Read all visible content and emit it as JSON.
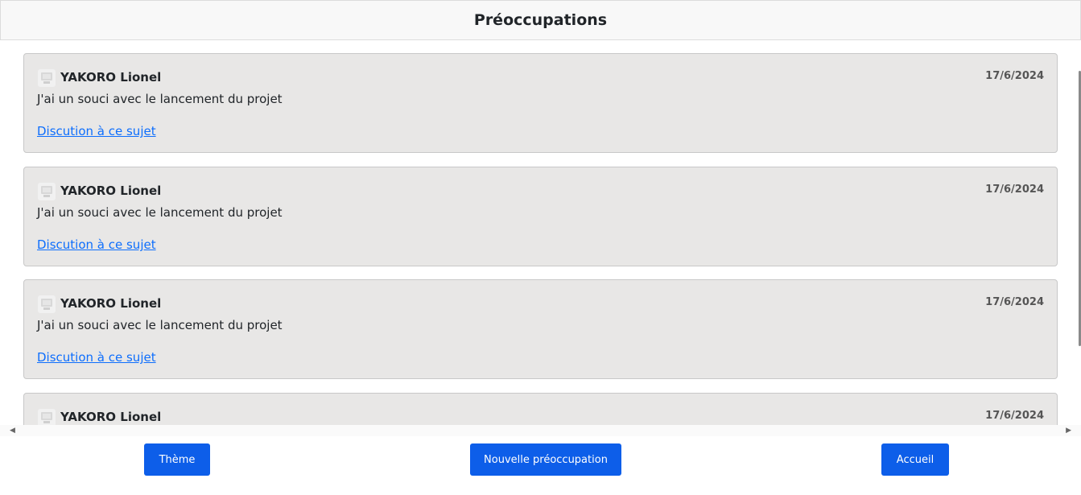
{
  "header": {
    "title": "Préoccupations"
  },
  "posts": [
    {
      "author": "YAKORO Lionel",
      "date": "17/6/2024",
      "message": "J'ai un souci avec le lancement du projet",
      "link": "Discution à ce sujet"
    },
    {
      "author": "YAKORO Lionel",
      "date": "17/6/2024",
      "message": "J'ai un souci avec le lancement du projet",
      "link": "Discution à ce sujet"
    },
    {
      "author": "YAKORO Lionel",
      "date": "17/6/2024",
      "message": "J'ai un souci avec le lancement du projet",
      "link": "Discution à ce sujet"
    },
    {
      "author": "YAKORO Lionel",
      "date": "17/6/2024"
    }
  ],
  "footer": {
    "theme_label": "Thème",
    "new_label": "Nouvelle préoccupation",
    "home_label": "Accueil"
  },
  "colors": {
    "accent": "#0d5ee9",
    "card_bg": "#e8e7e6",
    "link": "#0d6efd"
  },
  "icons": {
    "avatar": "user-avatar-icon",
    "scroll_left": "scroll-left-arrow-icon",
    "scroll_right": "scroll-right-arrow-icon"
  }
}
